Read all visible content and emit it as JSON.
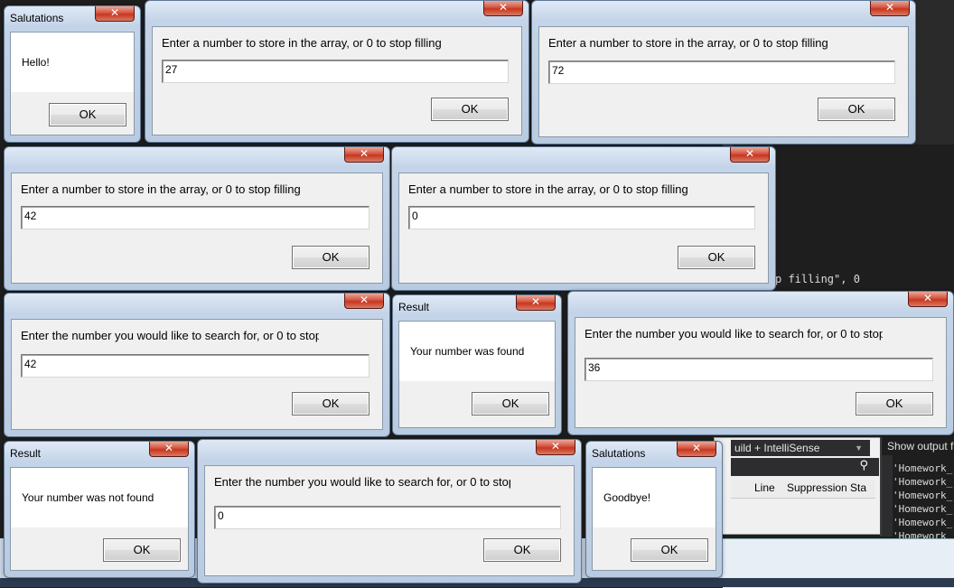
{
  "ide": {
    "code_fragment": "p filling\", 0",
    "error_scope": "uild + IntelliSense",
    "error_columns": [
      "Line",
      "Suppression Sta"
    ],
    "output_title": "Show output f",
    "output_lines": [
      "'Homework_",
      "'Homework_",
      "'Homework_",
      "'Homework_",
      "'Homework_",
      "'Homework_"
    ]
  },
  "dialogs": {
    "salutations_hello": {
      "title": "Salutations",
      "message": "Hello!",
      "ok": "OK"
    },
    "fill_1": {
      "prompt": "Enter a number to store in the array, or 0 to stop filling",
      "value": "27",
      "ok": "OK"
    },
    "fill_2": {
      "prompt": "Enter a number to store in the array, or 0 to stop filling",
      "value": "72",
      "ok": "OK"
    },
    "fill_3": {
      "prompt": "Enter a number to store in the array, or 0 to stop filling",
      "value": "42",
      "ok": "OK"
    },
    "fill_4": {
      "prompt": "Enter a number to store in the array, or 0 to stop filling",
      "value": "0",
      "ok": "OK"
    },
    "search_1": {
      "prompt": "Enter the number you would like to search for, or 0 to stop",
      "value": "42",
      "ok": "OK"
    },
    "result_found": {
      "title": "Result",
      "message": "Your number was found",
      "ok": "OK"
    },
    "search_2": {
      "prompt": "Enter the number you would like to search for, or 0 to stop",
      "value": "36",
      "ok": "OK"
    },
    "result_not_found": {
      "title": "Result",
      "message": "Your number was not found",
      "ok": "OK"
    },
    "search_3": {
      "prompt": "Enter the number you would like to search for, or 0 to stop",
      "value": "0",
      "ok": "OK"
    },
    "salutations_goodbye": {
      "title": "Salutations",
      "message": "Goodbye!",
      "ok": "OK"
    }
  },
  "close_glyph": "✕"
}
